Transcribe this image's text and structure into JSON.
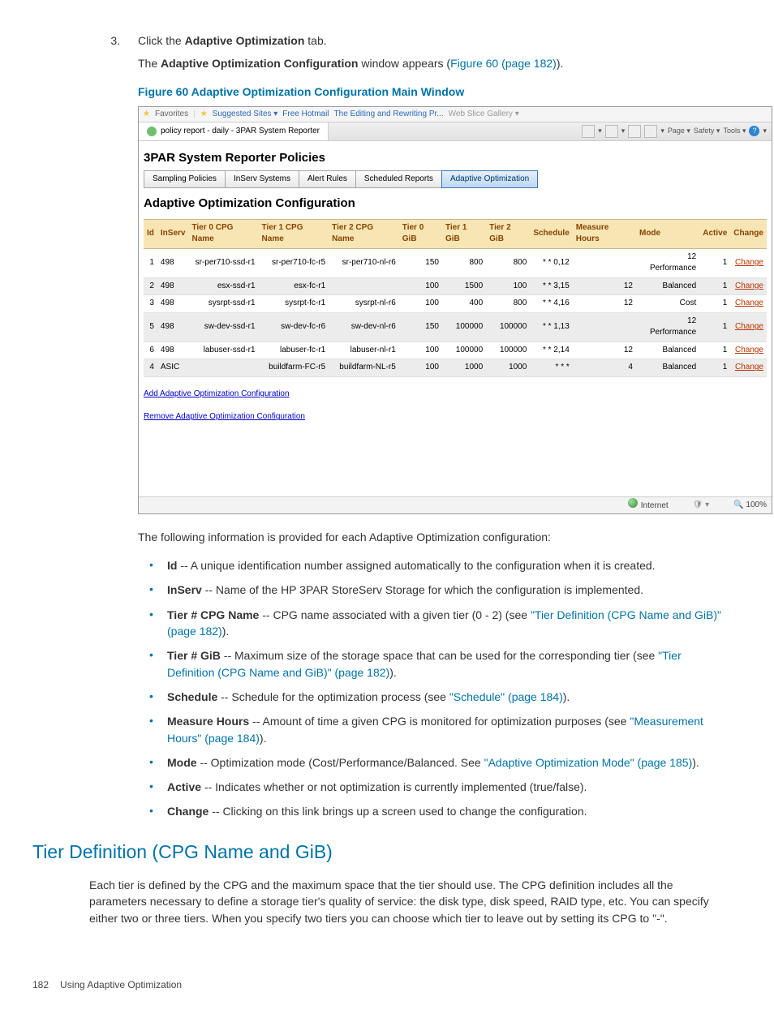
{
  "step": {
    "number": "3.",
    "prefix": "Click the ",
    "bold": "Adaptive Optimization",
    "suffix": " tab."
  },
  "subline": {
    "text_a": "The ",
    "bold": "Adaptive Optimization Configuration",
    "text_b": " window appears (",
    "link": "Figure 60 (page 182)",
    "text_c": ")."
  },
  "figure_title": "Figure 60 Adaptive Optimization Configuration Main Window",
  "ie": {
    "favorites": "Favorites",
    "suggested": "Suggested Sites ▾",
    "hotmail": "Free Hotmail",
    "editing": "The Editing and Rewriting Pr...",
    "gallery": "Web Slice Gallery ▾",
    "tab_title": "policy report - daily - 3PAR System Reporter",
    "tool_page": "Page ▾",
    "tool_safety": "Safety ▾",
    "tool_tools": "Tools ▾",
    "status_zone": "Internet",
    "status_zoom": "🔍 100%"
  },
  "report": {
    "title": "3PAR System Reporter Policies",
    "tabs": {
      "t0": "Sampling Policies",
      "t1": "InServ Systems",
      "t2": "Alert Rules",
      "t3": "Scheduled Reports",
      "t4": "Adaptive Optimization"
    },
    "cfg_heading": "Adaptive Optimization Configuration",
    "headers": {
      "id": "Id",
      "inserv": "InServ",
      "t0name": "Tier 0 CPG Name",
      "t1name": "Tier 1 CPG Name",
      "t2name": "Tier 2 CPG Name",
      "t0gib": "Tier 0 GiB",
      "t1gib": "Tier 1 GiB",
      "t2gib": "Tier 2 GiB",
      "sched": "Schedule",
      "mhrs": "Measure Hours",
      "mode": "Mode",
      "active": "Active",
      "change": "Change"
    },
    "rows": [
      {
        "id": "1",
        "inserv": "498",
        "t0": "sr-per710-ssd-r1",
        "t1": "sr-per710-fc-r5",
        "t2": "sr-per710-nl-r6",
        "g0": "150",
        "g1": "800",
        "g2": "800",
        "sch": "* * 0,12",
        "mh": "",
        "mode": "12 Performance",
        "act": "1",
        "chg": "Change",
        "stripe": false
      },
      {
        "id": "2",
        "inserv": "498",
        "t0": "esx-ssd-r1",
        "t1": "esx-fc-r1",
        "t2": "",
        "g0": "100",
        "g1": "1500",
        "g2": "100",
        "sch": "* * 3,15",
        "mh": "12",
        "mode": "Balanced",
        "act": "1",
        "chg": "Change",
        "stripe": true
      },
      {
        "id": "3",
        "inserv": "498",
        "t0": "sysrpt-ssd-r1",
        "t1": "sysrpt-fc-r1",
        "t2": "sysrpt-nl-r6",
        "g0": "100",
        "g1": "400",
        "g2": "800",
        "sch": "* * 4,16",
        "mh": "12",
        "mode": "Cost",
        "act": "1",
        "chg": "Change",
        "stripe": false
      },
      {
        "id": "5",
        "inserv": "498",
        "t0": "sw-dev-ssd-r1",
        "t1": "sw-dev-fc-r6",
        "t2": "sw-dev-nl-r6",
        "g0": "150",
        "g1": "100000",
        "g2": "100000",
        "sch": "* * 1,13",
        "mh": "",
        "mode": "12 Performance",
        "act": "1",
        "chg": "Change",
        "stripe": true
      },
      {
        "id": "6",
        "inserv": "498",
        "t0": "labuser-ssd-r1",
        "t1": "labuser-fc-r1",
        "t2": "labuser-nl-r1",
        "g0": "100",
        "g1": "100000",
        "g2": "100000",
        "sch": "* * 2,14",
        "mh": "12",
        "mode": "Balanced",
        "act": "1",
        "chg": "Change",
        "stripe": false
      },
      {
        "id": "4",
        "inserv": "ASIC",
        "t0": "",
        "t1": "buildfarm-FC-r5",
        "t2": "buildfarm-NL-r5",
        "g0": "100",
        "g1": "1000",
        "g2": "1000",
        "sch": "* * *",
        "mh": "4",
        "mode": "Balanced",
        "act": "1",
        "chg": "Change",
        "stripe": true
      }
    ],
    "add_link": "Add Adaptive Optimization Configuration",
    "remove_link": "Remove Adaptive Optimization Configuration"
  },
  "following_line": "The following information is provided for each Adaptive Optimization configuration:",
  "terms": {
    "id": {
      "b": "Id",
      "t": " -- A unique identification number assigned automatically to the configuration when it is created."
    },
    "inserv": {
      "b": "InServ",
      "t": " -- Name of the HP 3PAR StoreServ Storage for which the configuration is implemented."
    },
    "tname": {
      "b": "Tier # CPG Name",
      "t1": " -- CPG name associated with a given tier (0 - 2) (see ",
      "link": "\"Tier Definition (CPG Name and GiB)\" (page 182)",
      "t2": ")."
    },
    "tgib": {
      "b": "Tier # GiB",
      "t1": " -- Maximum size of the storage space that can be used for the corresponding tier (see ",
      "link": "\"Tier Definition (CPG Name and GiB)\" (page 182)",
      "t2": ")."
    },
    "sched": {
      "b": "Schedule",
      "t1": " -- Schedule for the optimization process (see ",
      "link": "\"Schedule\" (page 184)",
      "t2": ")."
    },
    "mhrs": {
      "b": "Measure Hours",
      "t1": " -- Amount of time a given CPG is monitored for optimization purposes (see ",
      "link": "\"Measurement Hours\" (page 184)",
      "t2": ")."
    },
    "mode": {
      "b": "Mode",
      "t1": " -- Optimization mode (Cost/Performance/Balanced. See ",
      "link": "\"Adaptive Optimization Mode\" (page 185)",
      "t2": ")."
    },
    "active": {
      "b": "Active",
      "t": " -- Indicates whether or not optimization is currently implemented (true/false)."
    },
    "change": {
      "b": "Change",
      "t": " -- Clicking on this link brings up a screen used to change the configuration."
    }
  },
  "section_title": "Tier Definition (CPG Name and GiB)",
  "tier_body": "Each tier is defined by the CPG and the maximum space that the tier should use. The CPG definition includes all the parameters necessary to define a storage tier's quality of service: the disk type, disk speed, RAID type, etc. You can specify either two or three tiers. When you specify two tiers you can choose which tier to leave out by setting its CPG to \"-\".",
  "footer": {
    "page": "182",
    "label": "Using Adaptive Optimization"
  }
}
